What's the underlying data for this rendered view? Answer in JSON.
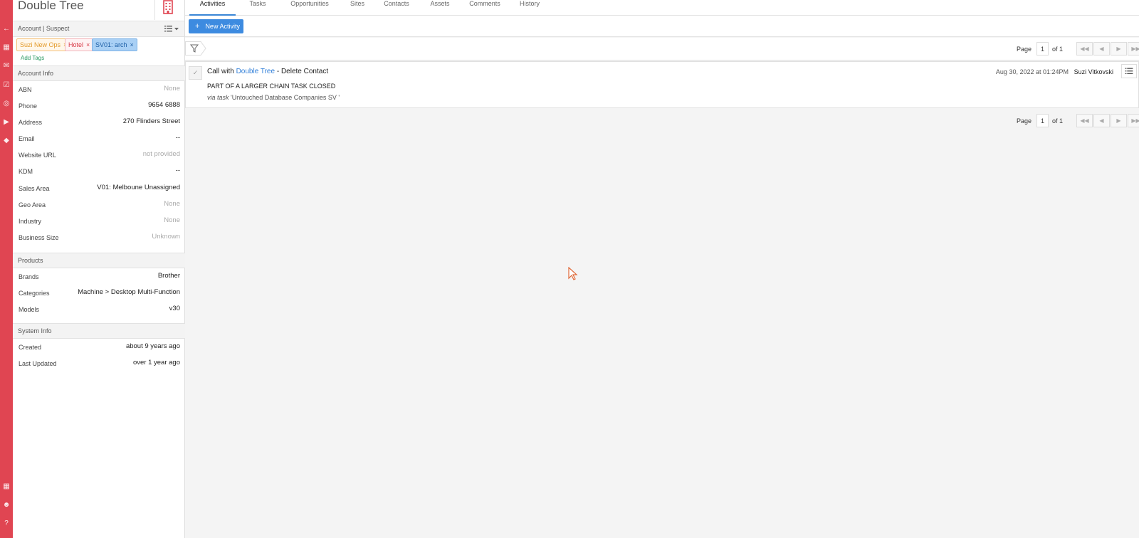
{
  "account": {
    "title": "Double Tree",
    "status": "Account | Suspect",
    "tags": [
      "Suzi New Ops",
      "Hotel",
      "SV01: arch"
    ],
    "add_tags": "Add Tags"
  },
  "sections": {
    "account_info": "Account Info",
    "products": "Products",
    "system_info": "System Info"
  },
  "account_info": [
    {
      "label": "ABN",
      "value": "None",
      "muted": true
    },
    {
      "label": "Phone",
      "value": "9654 6888",
      "muted": false
    },
    {
      "label": "Address",
      "value": "270 Flinders Street",
      "muted": false
    },
    {
      "label": "Email",
      "value": "--",
      "muted": false
    },
    {
      "label": "Website URL",
      "value": "not provided",
      "muted": true
    },
    {
      "label": "KDM",
      "value": "--",
      "muted": false
    },
    {
      "label": "Sales Area",
      "value": "V01: Melboune Unassigned",
      "muted": false
    },
    {
      "label": "Geo Area",
      "value": "None",
      "muted": true
    },
    {
      "label": "Industry",
      "value": "None",
      "muted": true
    },
    {
      "label": "Business Size",
      "value": "Unknown",
      "muted": true
    }
  ],
  "products": [
    {
      "label": "Brands",
      "value": "Brother"
    },
    {
      "label": "Categories",
      "value": "Machine > Desktop Multi-Function"
    },
    {
      "label": "Models",
      "value": "v30"
    }
  ],
  "system_info": [
    {
      "label": "Created",
      "value": "about 9 years ago"
    },
    {
      "label": "Last Updated",
      "value": "over 1 year ago"
    }
  ],
  "tabs": [
    "Activities",
    "Tasks",
    "Opportunities",
    "Sites",
    "Contacts",
    "Assets",
    "Comments",
    "History"
  ],
  "active_tab": "Activities",
  "toolbar": {
    "new_activity": "New Activity"
  },
  "pager": {
    "page_label": "Page",
    "page": "1",
    "of_label": "of 1"
  },
  "activity": {
    "title_prefix": "Call with",
    "title_link": "Double Tree",
    "title_suffix": "- Delete Contact",
    "note": "PART OF A LARGER CHAIN TASK CLOSED",
    "via_label": "via task",
    "via_value": "'Untouched Database Companies SV '",
    "date": "Aug 30, 2022 at 01:24PM",
    "user": "Suzi Vitkovski"
  },
  "colors": {
    "rail": "#e04552",
    "accent": "#3d8be0",
    "link": "#2f7ed8",
    "tag_ops": "#f0a030",
    "tag_hotel": "#e04552",
    "tag_arch_bg": "#a9d0f5"
  }
}
